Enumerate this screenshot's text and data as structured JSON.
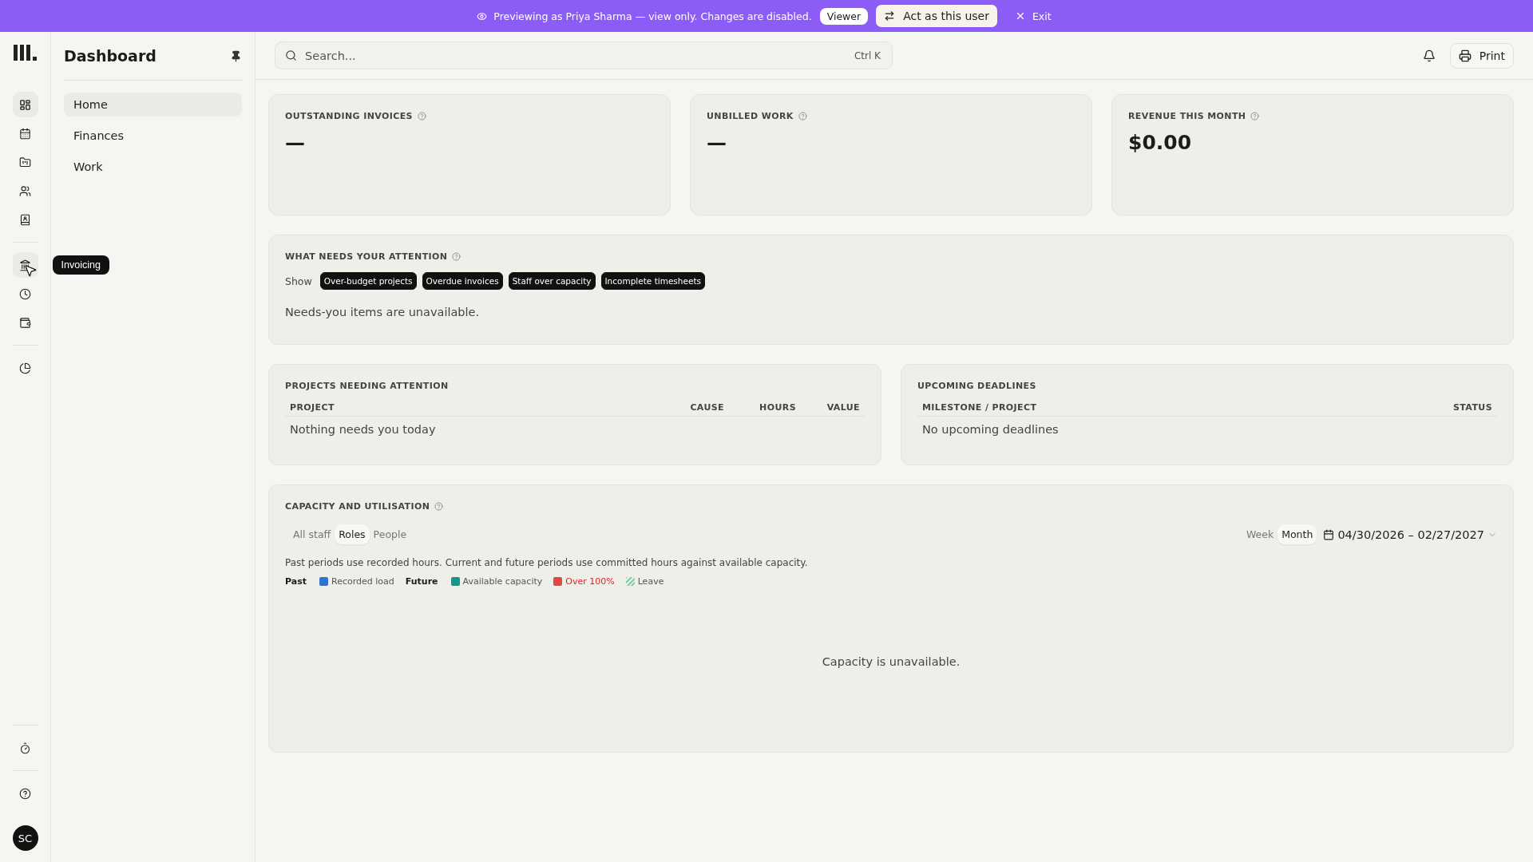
{
  "banner": {
    "message": "Previewing as Priya Sharma — view only. Changes are disabled.",
    "role_badge": "Viewer",
    "act_button": "Act as this user",
    "exit_button": "Exit"
  },
  "rail": {
    "groups": [
      {
        "items": [
          {
            "selected": true
          },
          {
            "selected": false
          },
          {
            "selected": false
          },
          {
            "selected": false
          },
          {
            "selected": false
          }
        ]
      },
      {
        "items": [
          {
            "selected": false,
            "hovered": true
          },
          {
            "selected": false
          },
          {
            "selected": false
          }
        ]
      },
      {
        "items": [
          {
            "selected": false
          }
        ]
      }
    ],
    "tooltip": "Invoicing",
    "avatar": "SC"
  },
  "sidebar": {
    "title": "Dashboard",
    "items": [
      {
        "label": "Home",
        "selected": true
      },
      {
        "label": "Finances",
        "selected": false
      },
      {
        "label": "Work",
        "selected": false
      }
    ]
  },
  "header": {
    "search_placeholder": "Search...",
    "shortcut": "Ctrl K",
    "print_button": "Print"
  },
  "metrics": [
    {
      "label": "OUTSTANDING INVOICES",
      "value": "—"
    },
    {
      "label": "UNBILLED WORK",
      "value": "—"
    },
    {
      "label": "REVENUE THIS MONTH",
      "value": "$0.00"
    }
  ],
  "attention": {
    "title": "WHAT NEEDS YOUR ATTENTION",
    "show_label": "Show",
    "filters": [
      {
        "label": "Over-budget projects",
        "selected": true
      },
      {
        "label": "Overdue invoices",
        "selected": true
      },
      {
        "label": "Staff over capacity",
        "selected": true
      },
      {
        "label": "Incomplete timesheets",
        "selected": true
      }
    ],
    "empty": "Needs-you items are unavailable."
  },
  "projects": {
    "title": "PROJECTS NEEDING ATTENTION",
    "columns": [
      "PROJECT",
      "CAUSE",
      "HOURS",
      "VALUE"
    ],
    "empty": "Nothing needs you today"
  },
  "deadlines": {
    "title": "UPCOMING DEADLINES",
    "columns": [
      "MILESTONE / PROJECT",
      "STATUS"
    ],
    "empty": "No upcoming deadlines"
  },
  "capacity": {
    "title": "CAPACITY AND UTILISATION",
    "tabs": [
      {
        "label": "All staff",
        "selected": false
      },
      {
        "label": "Roles",
        "selected": true
      },
      {
        "label": "People",
        "selected": false
      }
    ],
    "periods": [
      {
        "label": "Week",
        "selected": false
      },
      {
        "label": "Month",
        "selected": true
      }
    ],
    "date_range": "04/30/2026 – 02/27/2027",
    "note": "Past periods use recorded hours. Current and future periods use committed hours against available capacity.",
    "legend": [
      {
        "kind": "heading",
        "label": "Past"
      },
      {
        "kind": "solid",
        "label": "Recorded load",
        "color": "#2f74d0",
        "alert": false
      },
      {
        "kind": "heading",
        "label": "Future"
      },
      {
        "kind": "solid",
        "label": "Available capacity",
        "color": "#13968a",
        "alert": false
      },
      {
        "kind": "solid",
        "label": "Over 100%",
        "color": "#e04848",
        "alert": true
      },
      {
        "kind": "striped",
        "label": "Leave",
        "color": "#8fcaa8",
        "alert": false
      }
    ],
    "empty": "Capacity is unavailable."
  }
}
